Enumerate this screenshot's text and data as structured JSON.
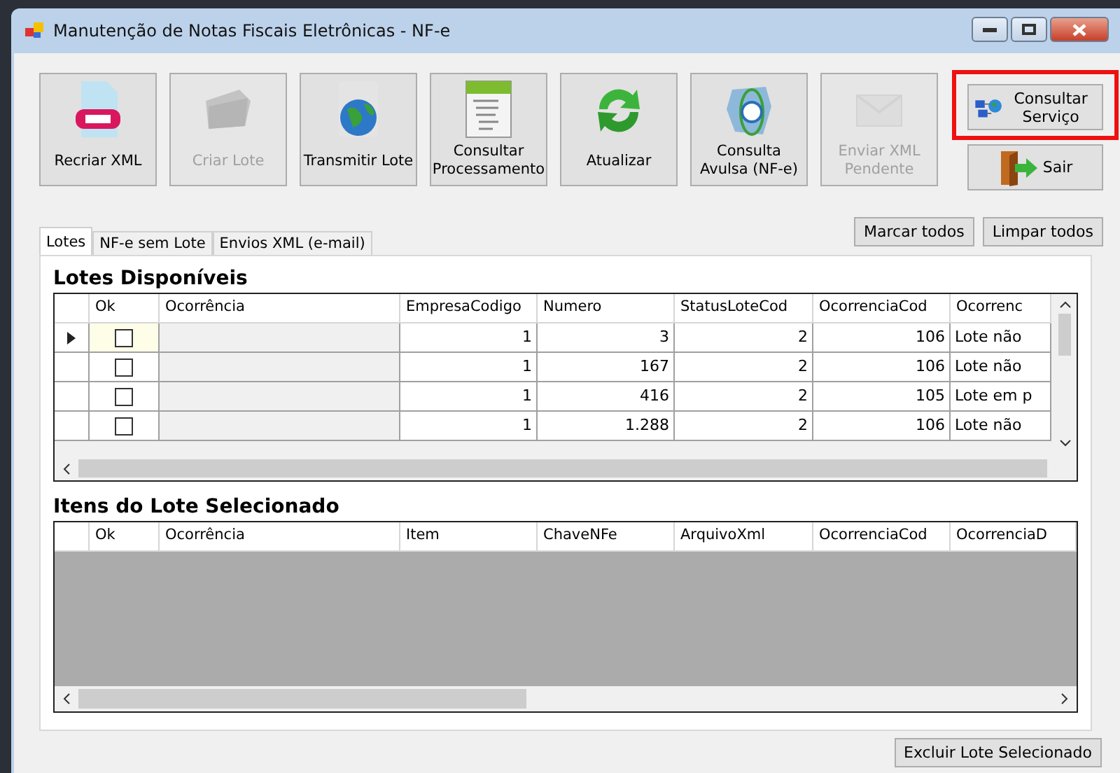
{
  "window": {
    "title": "Manutenção de Notas Fiscais Eletrônicas - NF-e"
  },
  "toolbar": [
    {
      "label": "Recriar XML",
      "disabled": false
    },
    {
      "label": "Criar Lote",
      "disabled": true
    },
    {
      "label": "Transmitir Lote",
      "disabled": false
    },
    {
      "label": "Consultar Processamento",
      "disabled": false
    },
    {
      "label": "Atualizar",
      "disabled": false
    },
    {
      "label": "Consulta Avulsa (NF-e)",
      "disabled": false
    },
    {
      "label": "Enviar XML Pendente",
      "disabled": true
    }
  ],
  "side_buttons": [
    {
      "label": "Consultar Serviço",
      "highlighted": true
    },
    {
      "label": "Sair",
      "highlighted": false
    }
  ],
  "tabs": [
    {
      "label": "Lotes",
      "selected": true
    },
    {
      "label": "NF-e sem Lote",
      "selected": false
    },
    {
      "label": "Envios XML (e-mail)",
      "selected": false
    }
  ],
  "tab_buttons": [
    "Marcar todos",
    "Limpar todos"
  ],
  "lotes": {
    "title": "Lotes Disponíveis",
    "columns": [
      "Ok",
      "Ocorrência",
      "EmpresaCodigo",
      "Numero",
      "StatusLoteCod",
      "OcorrenciaCod",
      "Ocorrenc"
    ],
    "rows": [
      {
        "current": true,
        "checked": false,
        "cells": [
          "",
          "",
          "1",
          "3",
          "2",
          "106",
          "Lote não"
        ]
      },
      {
        "current": false,
        "checked": false,
        "cells": [
          "",
          "",
          "1",
          "167",
          "2",
          "106",
          "Lote não"
        ]
      },
      {
        "current": false,
        "checked": false,
        "cells": [
          "",
          "",
          "1",
          "416",
          "2",
          "105",
          "Lote em p"
        ]
      },
      {
        "current": false,
        "checked": false,
        "cells": [
          "",
          "",
          "1",
          "1.288",
          "2",
          "106",
          "Lote não"
        ]
      }
    ]
  },
  "itens": {
    "title": "Itens do Lote Selecionado",
    "columns": [
      "Ok",
      "Ocorrência",
      "Item",
      "ChaveNFe",
      "ArquivoXml",
      "OcorrenciaCod",
      "OcorrenciaD"
    ]
  },
  "footer_button": "Excluir Lote Selecionado"
}
